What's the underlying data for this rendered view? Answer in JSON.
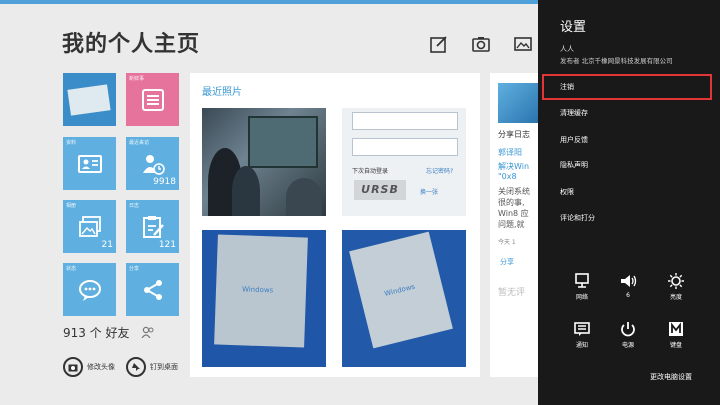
{
  "page": {
    "title": "我的个人主页"
  },
  "tiles": {
    "news": {
      "label": "新鲜事"
    },
    "profile": {
      "label": "资料"
    },
    "visitors": {
      "label": "最近来访",
      "count": "9918"
    },
    "albums": {
      "label": "相册",
      "count": "21"
    },
    "logs": {
      "label": "日志",
      "count": "121"
    },
    "status": {
      "label": "状态"
    },
    "share": {
      "label": "分享"
    }
  },
  "friends": {
    "count_text": "913 个 好友"
  },
  "bottom_actions": {
    "change_avatar": "修改头像",
    "pin": "钉到桌面"
  },
  "photos": {
    "title": "最近照片",
    "login": {
      "remember": "下次自动登录",
      "forgot": "忘记密码?",
      "captcha": "URSB",
      "refresh": "换一张"
    },
    "windows_logo": "Windows"
  },
  "share_panel": {
    "lines": [
      "分享日志",
      "郭译阳",
      "解决Win",
      "\"0x8",
      "关闭系统",
      "很的事,",
      "Win8 应",
      "问题,就"
    ],
    "time": "今天 1",
    "share_btn": "分享",
    "no_comment": "暂无评"
  },
  "settings": {
    "title": "设置",
    "app_name": "人人",
    "publisher": "发布者 北京千橡网景科技发展有限公司",
    "menu": [
      "注销",
      "清理缓存",
      "用户反馈",
      "隐私声明",
      "权限",
      "评论和打分"
    ],
    "quick": [
      {
        "icon": "network-icon",
        "label": "网络"
      },
      {
        "icon": "volume-icon",
        "label": "6"
      },
      {
        "icon": "brightness-icon",
        "label": "亮度"
      },
      {
        "icon": "notification-icon",
        "label": "通知"
      },
      {
        "icon": "power-icon",
        "label": "电源"
      },
      {
        "icon": "keyboard-icon",
        "label": "键盘"
      }
    ],
    "more": "更改电脑设置"
  },
  "colors": {
    "tile_blue": "#5fb0e0",
    "tile_pink": "#e5739b",
    "charm_bg": "#191919",
    "highlight": "#e23636",
    "accent": "#3a97d4"
  }
}
